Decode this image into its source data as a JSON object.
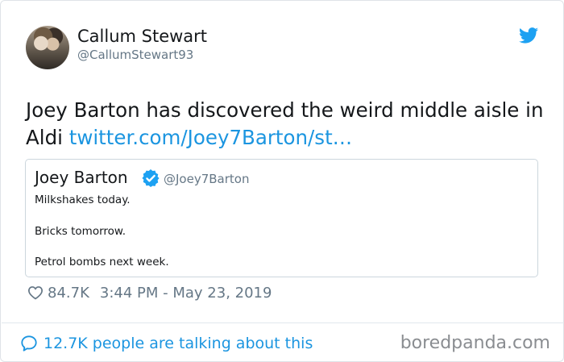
{
  "author": {
    "name": "Callum Stewart",
    "handle": "@CallumStewart93"
  },
  "tweet": {
    "text": "Joey Barton has discovered the weird middle aisle in Aldi",
    "link": "twitter.com/Joey7Barton/st…"
  },
  "quoted_tweet": {
    "name": "Joey Barton",
    "handle": "@Joey7Barton",
    "lines": [
      "Milkshakes today.",
      "Bricks tomorrow.",
      "Petrol bombs next week."
    ]
  },
  "meta": {
    "likes": "84.7K",
    "timestamp": "3:44 PM - May 23, 2019"
  },
  "footer": {
    "talking": "12.7K people are talking about this",
    "watermark": "boredpanda.com"
  },
  "icons": {
    "bird": "twitter-bird-icon",
    "verified": "verified-badge-icon",
    "heart": "heart-outline-icon",
    "bubble": "speech-bubble-icon"
  },
  "colors": {
    "link": "#1b95e0",
    "muted": "#657786",
    "text": "#14171a"
  }
}
